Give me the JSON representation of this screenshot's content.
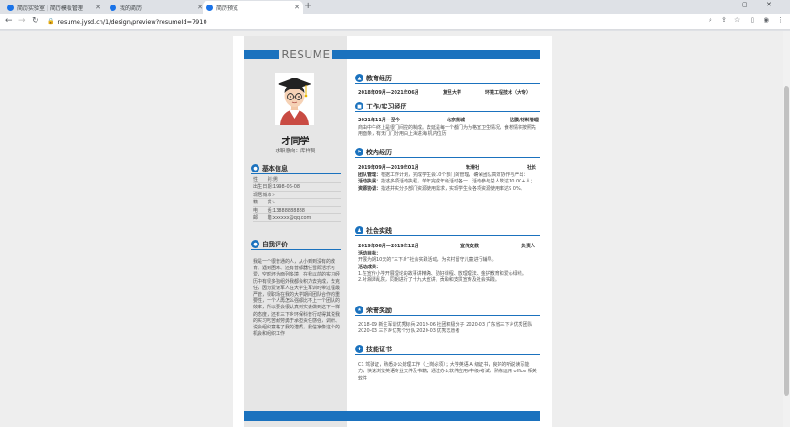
{
  "browser": {
    "tabs": [
      {
        "title": "简历实验室 | 简历模板管理",
        "active": false
      },
      {
        "title": "我的简历",
        "active": false
      },
      {
        "title": "简历预览",
        "active": true
      }
    ],
    "new_tab": "+",
    "url": "resume.jysd.cn/1/design/preview?resumeId=7910",
    "window_controls": {
      "minimize": "—",
      "maximize": "▢",
      "close": "✕"
    },
    "icons": [
      "back-icon",
      "forward-icon",
      "reload-icon",
      "lock-icon",
      "search-icon",
      "share-icon",
      "star-icon",
      "sidebar-icon",
      "profile-icon",
      "menu-icon"
    ]
  },
  "resume": {
    "header_word": "RESUME",
    "name": "才同学",
    "intent": "求职意向：库样员",
    "left": {
      "basic_title": "基本信息",
      "basic_info": [
        {
          "label": "性　　别：",
          "value": "男"
        },
        {
          "label": "出生日期：",
          "value": "1998-06-08"
        },
        {
          "label": "现居城市：",
          "value": "-"
        },
        {
          "label": "籍　　贯：",
          "value": "-"
        },
        {
          "label": "电　　话：",
          "value": "13888888888"
        },
        {
          "label": "邮　　箱：",
          "value": "xxxxxx@qq.com"
        }
      ],
      "self_title": "自我评价",
      "self_eval": "我是一个很普通的人，从小到到没有的教育、遇到困难、还有普都器任雪即活乐可爱，空时坏为面列多境，在我以前的实习经历中有很多独组外我都会积力去完成，去克任，因为爱读军人在大学生军训时带过程最严管，很职场在我的大学期间团队合作的重要性，一个人再怎么强都比不上一个团队的效率，所以要会很认真到实去做到这下一样的态度，还有三下乡环保科普行动得其说我的实习吃苦耐劳勇于承担责任感强，调研、说会组织意格了我的潜质，我信家像这个的机会和组织工作"
    },
    "right": {
      "sections": [
        {
          "title": "教育经历",
          "icon": "graduation-icon"
        },
        {
          "title": "工作/实习经历",
          "icon": "briefcase-icon"
        },
        {
          "title": "校内经历",
          "icon": "flag-icon"
        },
        {
          "title": "社会实践",
          "icon": "people-icon"
        },
        {
          "title": "荣誉奖励",
          "icon": "trophy-icon"
        },
        {
          "title": "技能证书",
          "icon": "gear-icon"
        }
      ],
      "education": {
        "date": "2018年09月—2021年06月",
        "school": "复旦大学",
        "major": "环境工程技术（大专）"
      },
      "work": {
        "date": "2021年11月—至今",
        "company": "北京熊城",
        "position": "贴膜/材料管理",
        "desc": "商由中午终上是很门间控的制成。去延是每一个都门为为格室卫生情况，食材情将按照先用面条，有无门门分用由上海进海 机内位历"
      },
      "campus": {
        "date": "2019年09月—2019年01月",
        "org": "轮滑社",
        "role": "社长",
        "items": [
          {
            "label": "团队管理：",
            "text": "根据工作计划，完成学生会10个部门的管理，确保团队高效协作与严出："
          },
          {
            "label": "活动执展：",
            "text": "指述多项活动执程，单年完成年级活动各一、活动参与总人数达10 00+人；"
          },
          {
            "label": "资源协调：",
            "text": "指述并实分多部门资源使用需求，实现学生会各项资源使用率达9 0%。"
          }
        ]
      },
      "practice": {
        "date": "2019年06月—2019年12月",
        "org": "宣传支教",
        "role": "负责人",
        "label1": "活动目标：",
        "text1": "开展为期10天的“三下乡”社会实践活动，为农村留守儿童进行辅导。",
        "label2": "活动成果：",
        "text2": "1.在宣传小学开展理论的故事讲精确、勤好课程、放理理法、金护教育和爱心绿线。",
        "text3": "2.对湘潭乱院，同朝进行了十九大宣讲，贡助和支贯宣传及社会实践。"
      },
      "honors": "2018-09 新生军训优秀标兵 2019-06 社团积极分子 2020-03 广东省三下乡优秀团队 2020-03 三下乡优秀个分队 2020-03 优秀志愿者",
      "skills": "C1 驾驶证，熟悉办公处理工作（上岗必须）；大学英语 A 级证书，良好的听说读写能力，快速浏览英语专业文件及书籍；通过办公软件应用(中级)考试，熟练运用 office 相关软件"
    }
  }
}
